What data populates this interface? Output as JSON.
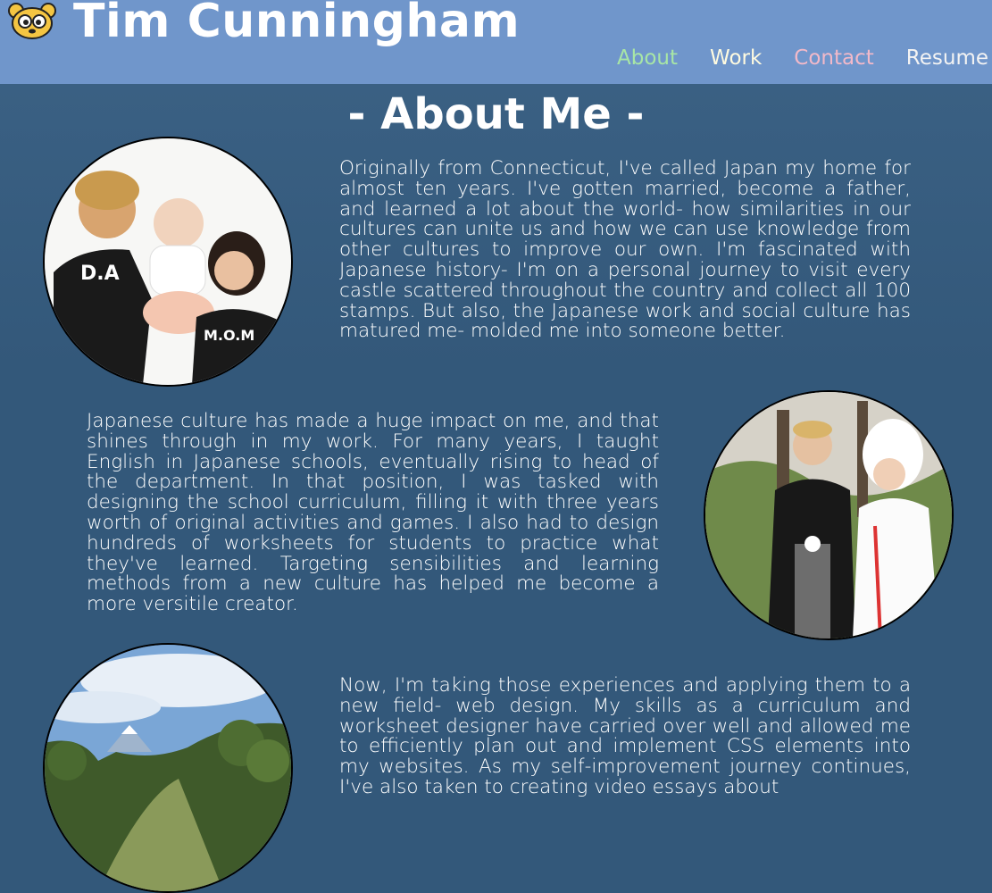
{
  "header": {
    "title": "Tim Cunningham",
    "logo_icon": "bear-face-icon",
    "nav": [
      {
        "label": "About",
        "color": "#a8e6a6"
      },
      {
        "label": "Work",
        "color": "#fffbe0"
      },
      {
        "label": "Contact",
        "color": "#f2b9c9"
      },
      {
        "label": "Resume",
        "color": "#f3f3f3"
      }
    ]
  },
  "main": {
    "heading": "- About Me -",
    "sections": [
      {
        "text": "Originally from Connecticut, I've called Japan my home for almost ten years. I've gotten married, become a father, and learned a lot about the world- how similarities in our cultures can unite us and how we can use knowledge from other cultures to improve our own. I'm fascinated with Japanese history- I'm on a personal journey to visit every castle scattered throughout the country and collect all 100 stamps. But also, the Japanese work and social culture has matured me- molded me into someone better.",
        "photo": "family-photo"
      },
      {
        "text": "Japanese culture has made a huge impact on me, and that shines through in my work. For many years, I taught English in Japanese schools, eventually rising to head of the department. In that position, I was tasked with designing the school curriculum, filling it with three years worth of original activities and games. I also had to design hundreds of worksheets for students to practice what they've learned. Targeting sensibilities and learning methods from a new culture has helped me become a more versitile creator.",
        "photo": "wedding-photo"
      },
      {
        "text": "Now, I'm taking those experiences and applying them to a new field- web design. My skills as a curriculum and worksheet designer have carried over well and allowed me to efficiently plan out and implement CSS elements into my websites. As my self-improvement journey continues, I've also taken to creating video essays about",
        "photo": "landscape-photo"
      }
    ]
  },
  "colors": {
    "header_bg": "#7096cb",
    "page_bg": "#33587a"
  }
}
